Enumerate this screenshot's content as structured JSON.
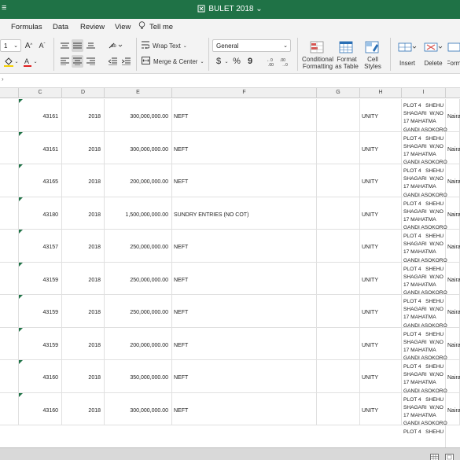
{
  "window": {
    "title": "BULET 2018",
    "title_suffix": "⌄",
    "left_text": "≡"
  },
  "menu": {
    "items": [
      "Formulas",
      "Data",
      "Review",
      "View"
    ],
    "tellme": "Tell me"
  },
  "ribbon": {
    "font_size": "1",
    "wrap_text": "Wrap Text",
    "merge_center": "Merge & Center",
    "number_format": "General",
    "currency": "$",
    "percent": "%",
    "comma": "9",
    "conditional_formatting": [
      "Conditional",
      "Formatting"
    ],
    "format_as_table": [
      "Format",
      "as Table"
    ],
    "cell_styles": [
      "Cell",
      "Styles"
    ],
    "insert": "Insert",
    "delete": "Delete",
    "format": "Form"
  },
  "columns": [
    "C",
    "D",
    "E",
    "F",
    "G",
    "H",
    "I"
  ],
  "rows": [
    {
      "c": "43161",
      "d": "2018",
      "e": "300,000,000.00",
      "f": "NEFT",
      "h": "UNITY",
      "i": "PLOT 4   SHEHU\nSHAGARI  W,NO\n17 MAHATMA\nGANDI ASOKORO",
      "j": "Naira"
    },
    {
      "c": "43161",
      "d": "2018",
      "e": "300,000,000.00",
      "f": "NEFT",
      "h": "UNITY",
      "i": "PLOT 4   SHEHU\nSHAGARI  W,NO\n17 MAHATMA\nGANDI ASOKORO",
      "j": "Naira"
    },
    {
      "c": "43165",
      "d": "2018",
      "e": "200,000,000.00",
      "f": "NEFT",
      "h": "UNITY",
      "i": "PLOT 4   SHEHU\nSHAGARI  W,NO\n17 MAHATMA\nGANDI ASOKORO",
      "j": "Naira"
    },
    {
      "c": "43180",
      "d": "2018",
      "e": "1,500,000,000.00",
      "f": "SUNDRY ENTRIES (NO COT)",
      "h": "UNITY",
      "i": "PLOT 4   SHEHU\nSHAGARI  W,NO\n17 MAHATMA\nGANDI ASOKORO",
      "j": "Naira"
    },
    {
      "c": "43157",
      "d": "2018",
      "e": "250,000,000.00",
      "f": "NEFT",
      "h": "UNITY",
      "i": "PLOT 4   SHEHU\nSHAGARI  W,NO\n17 MAHATMA\nGANDI ASOKORO",
      "j": "Naira"
    },
    {
      "c": "43159",
      "d": "2018",
      "e": "250,000,000.00",
      "f": "NEFT",
      "h": "UNITY",
      "i": "PLOT 4   SHEHU\nSHAGARI  W,NO\n17 MAHATMA\nGANDI ASOKORO",
      "j": "Naira"
    },
    {
      "c": "43159",
      "d": "2018",
      "e": "250,000,000.00",
      "f": "NEFT",
      "h": "UNITY",
      "i": "PLOT 4   SHEHU\nSHAGARI  W,NO\n17 MAHATMA\nGANDI ASOKORO",
      "j": "Naira"
    },
    {
      "c": "43159",
      "d": "2018",
      "e": "200,000,000.00",
      "f": "NEFT",
      "h": "UNITY",
      "i": "PLOT 4   SHEHU\nSHAGARI  W,NO\n17 MAHATMA\nGANDI ASOKORO",
      "j": "Naira"
    },
    {
      "c": "43160",
      "d": "2018",
      "e": "350,000,000.00",
      "f": "NEFT",
      "h": "UNITY",
      "i": "PLOT 4   SHEHU\nSHAGARI  W,NO\n17 MAHATMA\nGANDI ASOKORO",
      "j": "Naira"
    },
    {
      "c": "43160",
      "d": "2018",
      "e": "300,000,000.00",
      "f": "NEFT",
      "h": "UNITY",
      "i": "PLOT 4   SHEHU\nSHAGARI  W,NO\n17 MAHATMA\nGANDI ASOKORO",
      "j": "Naira"
    }
  ],
  "partial_row": {
    "i": "PLOT 4   SHEHU"
  },
  "colors": {
    "excel_green": "#1f7246"
  }
}
